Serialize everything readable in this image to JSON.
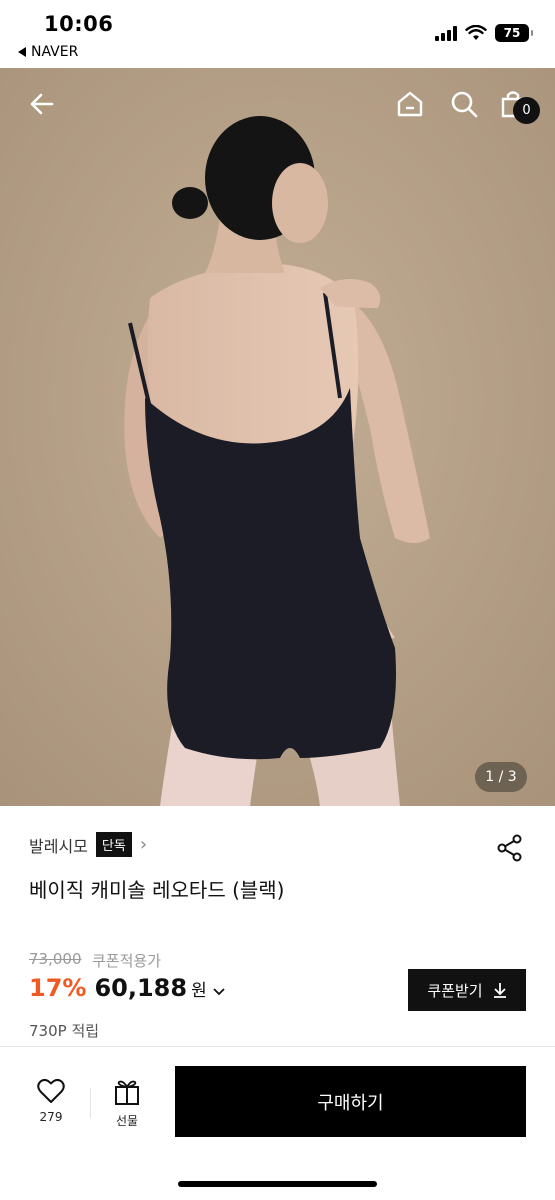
{
  "status_bar": {
    "time": "10:06",
    "back_app": "NAVER",
    "battery": "75"
  },
  "hero": {
    "page_indicator": "1 / 3",
    "cart_count": "0",
    "icons": [
      "back-arrow-icon",
      "home-icon",
      "search-icon",
      "cart-icon"
    ],
    "image_description": "model-wearing-black-leotard-photo"
  },
  "product": {
    "brand": "발레시모",
    "brand_badge": "단독",
    "title": "베이직 캐미솔 레오타드 (블랙)",
    "original_price": "73,000",
    "price_note": "쿠폰적용가",
    "discount": "17%",
    "price": "60,188",
    "currency": "원",
    "coupon_button": "쿠폰받기",
    "points": "730P 적립"
  },
  "bottom_bar": {
    "like_count": "279",
    "gift_label": "선물",
    "buy_label": "구매하기"
  },
  "colors": {
    "accent": "#f05a22",
    "dark": "#111111",
    "hero_bg": "#b39f86"
  }
}
